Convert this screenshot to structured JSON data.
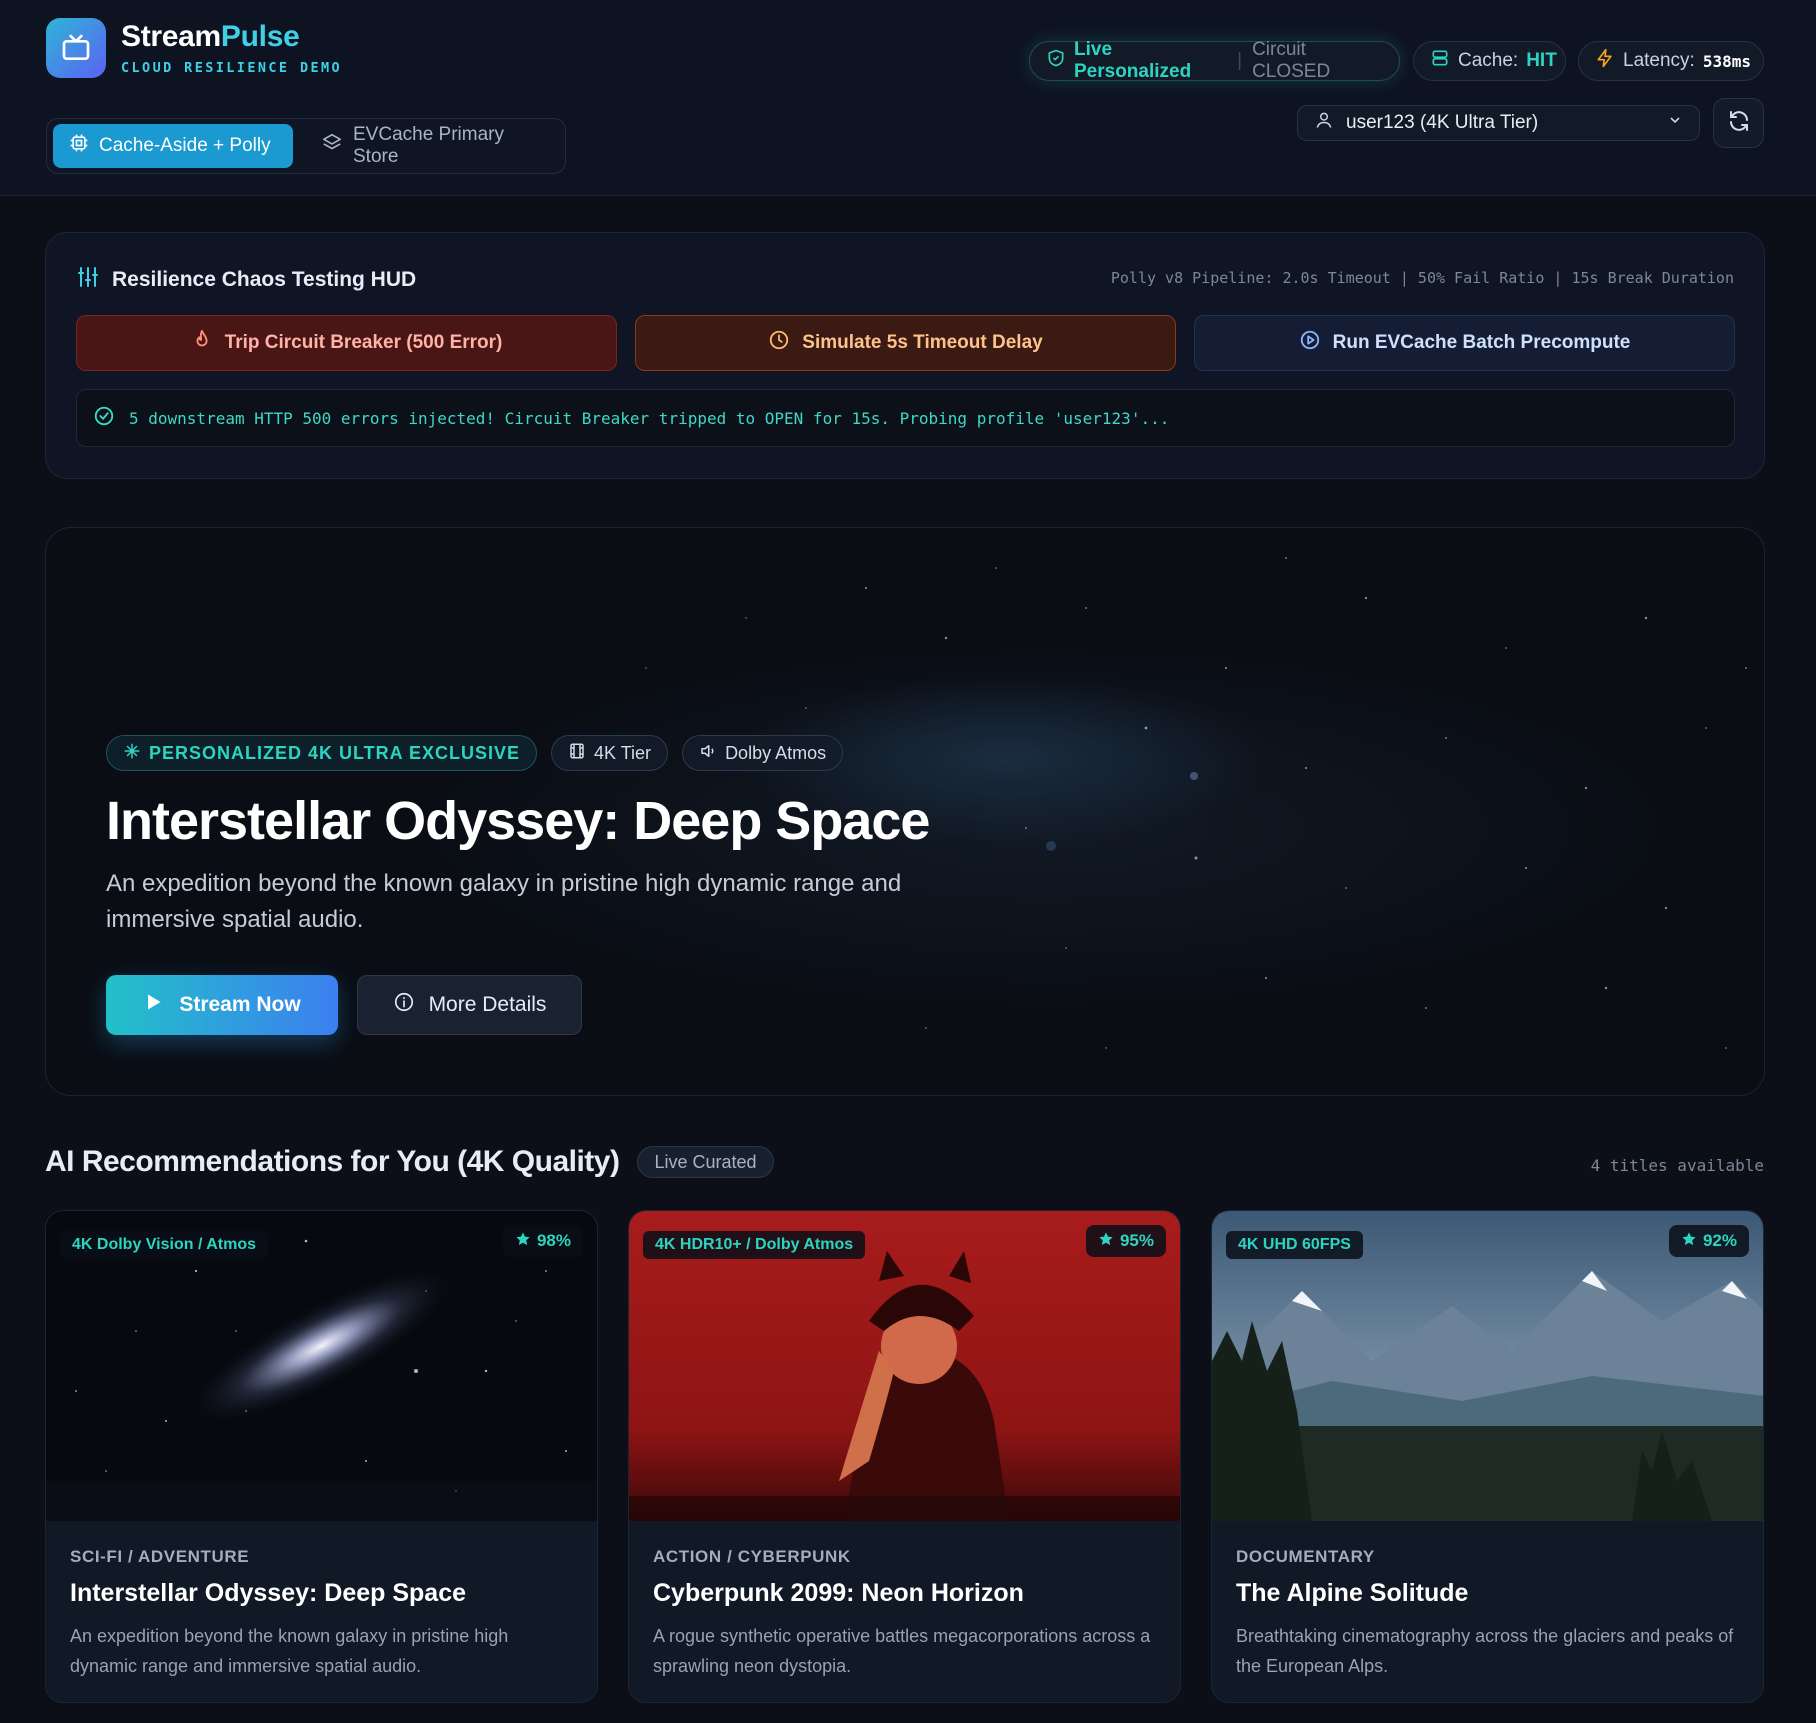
{
  "header": {
    "brand_a": "Stream",
    "brand_b": "Pulse",
    "subtitle": "CLOUD RESILIENCE DEMO",
    "tabs": [
      {
        "label": "Cache-Aside + Polly",
        "icon": "chip-icon",
        "active": true
      },
      {
        "label": "EVCache Primary Store",
        "icon": "layers-icon",
        "active": false
      }
    ],
    "status": {
      "live_label": "Live Personalized",
      "circuit_label": "Circuit CLOSED",
      "cache_label": "Cache:",
      "cache_value": "HIT",
      "latency_label": "Latency:",
      "latency_value": "538ms"
    },
    "user_select": "user123 (4K Ultra Tier)"
  },
  "hud": {
    "title": "Resilience Chaos Testing HUD",
    "meta": "Polly v8 Pipeline: 2.0s Timeout | 50% Fail Ratio | 15s Break Duration",
    "buttons": [
      {
        "label": "Trip Circuit Breaker (500 Error)",
        "icon": "flame-icon"
      },
      {
        "label": "Simulate 5s Timeout Delay",
        "icon": "clock-icon"
      },
      {
        "label": "Run EVCache Batch Precompute",
        "icon": "play-circle-icon"
      }
    ],
    "log": "5 downstream HTTP 500 errors injected! Circuit Breaker tripped to OPEN for 15s. Probing profile 'user123'..."
  },
  "hero": {
    "chips": [
      "PERSONALIZED 4K ULTRA EXCLUSIVE",
      "4K Tier",
      "Dolby Atmos"
    ],
    "title": "Interstellar Odyssey: Deep Space",
    "description": "An expedition beyond the known galaxy in pristine high dynamic range and immersive spatial audio.",
    "primary_button": "Stream Now",
    "secondary_button": "More Details"
  },
  "recommendations": {
    "title": "AI Recommendations for You (4K Quality)",
    "badge": "Live Curated",
    "count": "4 titles available",
    "items": [
      {
        "tag": "4K Dolby Vision / Atmos",
        "rating": "98%",
        "genre": "SCI-FI / ADVENTURE",
        "title": "Interstellar Odyssey: Deep Space",
        "description": "An expedition beyond the known galaxy in pristine high dynamic range and immersive spatial audio."
      },
      {
        "tag": "4K HDR10+ / Dolby Atmos",
        "rating": "95%",
        "genre": "ACTION / CYBERPUNK",
        "title": "Cyberpunk 2099: Neon Horizon",
        "description": "A rogue synthetic operative battles megacorporations across a sprawling neon dystopia."
      },
      {
        "tag": "4K UHD 60FPS",
        "rating": "92%",
        "genre": "DOCUMENTARY",
        "title": "The Alpine Solitude",
        "description": "Breathtaking cinematography across the glaciers and peaks of the European Alps."
      }
    ]
  },
  "colors": {
    "accent": "#2dd4bf",
    "brand_gradient_start": "#2fb4d8",
    "brand_gradient_end": "#5b62f2",
    "background": "#0c0f17"
  }
}
